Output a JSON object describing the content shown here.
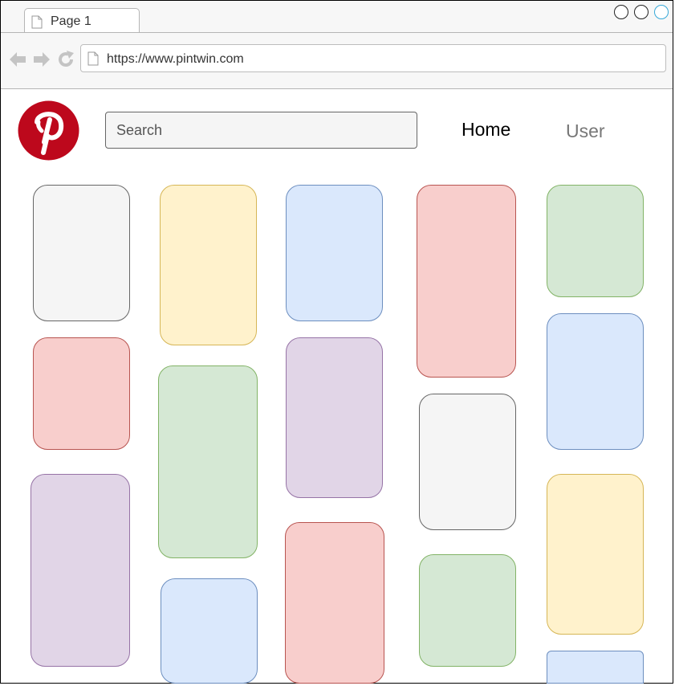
{
  "browser": {
    "tab_title": "Page 1",
    "url": "https://www.pintwin.com"
  },
  "header": {
    "logo_icon": "pinterest-logo-icon",
    "logo_color": "#bd081c",
    "search_placeholder": "Search",
    "nav": {
      "home": "Home",
      "user": "User"
    }
  },
  "colors": {
    "gray": "#f5f5f5",
    "yellow": "#fff2cc",
    "blue": "#dae8fc",
    "red": "#f8cecc",
    "green": "#d5e8d4",
    "purple": "#e1d5e7"
  }
}
